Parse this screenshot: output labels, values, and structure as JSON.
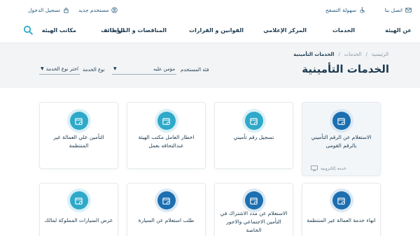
{
  "topbar": {
    "contact": "اتصل بنا",
    "accessibility": "سهولة التصفح",
    "new_user": "مستخدم جديد",
    "login": "تسجيل الدخول"
  },
  "nav": {
    "items": [
      "عن الهيئة",
      "الخدمات",
      "المركز الإعلامي",
      "القوانين و القرارات",
      "المناقصات و المزايدات",
      "الوظائف",
      "مكاتب الهيئة"
    ]
  },
  "breadcrumb": {
    "home": "الرئيسية",
    "services": "الخدمات",
    "current": "الخدمات التأمينية"
  },
  "page_title": "الخدمات التأمينية",
  "filters": {
    "user_category_label": "فئة المستخدم",
    "user_category_value": "مؤمن عليه",
    "service_type_label": "نوع الخدمة",
    "service_type_value": "اختر نوع الخدمة"
  },
  "cards": [
    {
      "title": "الاستعلام عن الرقم التأميني بالرقم القومى",
      "tag": "خدمة إلكترونية",
      "icon": "calendar-gear-icon"
    },
    {
      "title": "تسجيل رقم تأميني",
      "icon": "calendar-gear-icon"
    },
    {
      "title": "اخطار العامل مكتب الهيئة عندالتحاقه بعمل",
      "icon": "calendar-gear-icon"
    },
    {
      "title": "التأمين علي العمالة غير المنتظمة",
      "icon": "calendar-gear-icon"
    },
    {
      "title": "انهاء خدمة العمالة غير المنتظمة",
      "icon": "calendar-gear-icon"
    },
    {
      "title": "الاستعلام عن مدد الاشتراك في التأمين الاجتماعي والاجور الخاصة",
      "icon": "calendar-gear-icon"
    },
    {
      "title": "طلب استعلام عن السيارة",
      "icon": "calendar-gear-icon"
    },
    {
      "title": "عرض السيارات المملوكة لمالك",
      "icon": "calendar-gear-icon"
    }
  ],
  "colors": {
    "teal": "#2fa9c9",
    "navy": "#1c6fb0",
    "text": "#1d3a4f",
    "band": "#f2f4f6"
  }
}
